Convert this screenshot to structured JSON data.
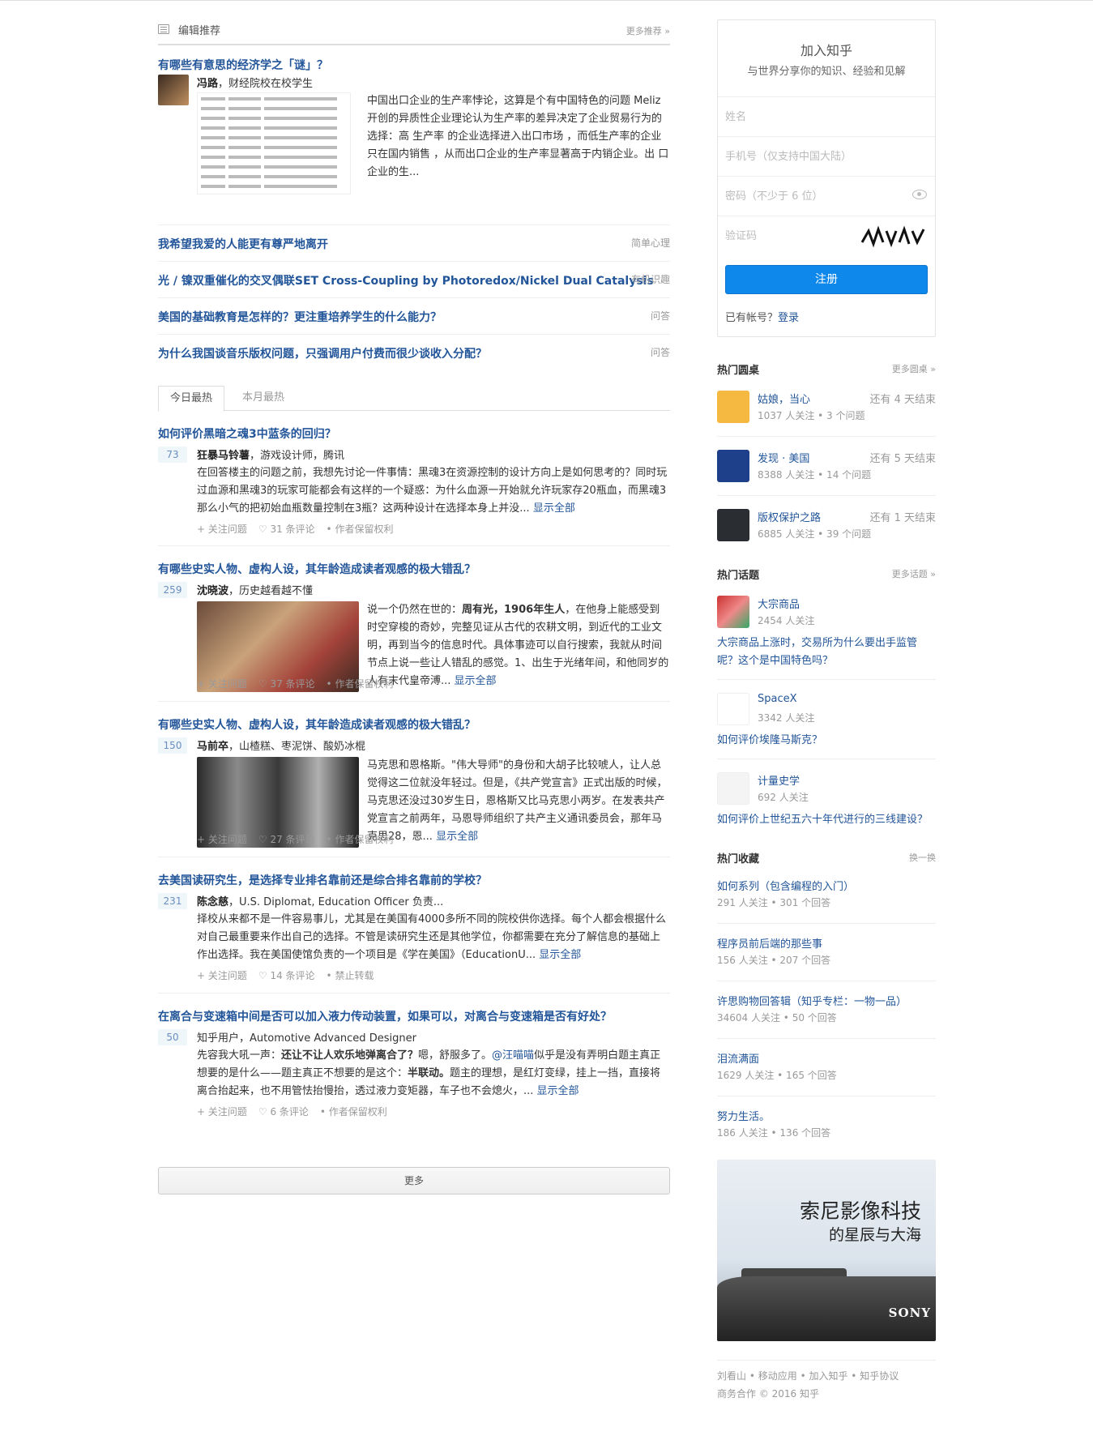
{
  "editor": {
    "section_title": "编辑推荐",
    "more": "更多推荐 »",
    "featured": {
      "question": "有哪些有意思的经济学之「谜」？",
      "author_name": "冯路",
      "author_bio": "，财经院校在校学生",
      "summary": "中国出口企业的生产率悖论，这算是个有中国特色的问题 Meliz开创的异质性企业理论认为生产率的差异决定了企业贸易行为的选择：高 生产率 的企业选择进入出口市场 ，而低生产率的企业只在国内销售 ，从而出口企业的生产率显著高于内销企业。出 口企业的生..."
    },
    "rows": [
      {
        "title": "我希望我爱的人能更有尊严地离开",
        "tag": "简单心理"
      },
      {
        "title": "光 / 镍双重催化的交叉偶联SET Cross-Coupling by Photoredox/Nickel Dual Catalysis",
        "tag": "有机识趣"
      },
      {
        "title": "美国的基础教育是怎样的？更注重培养学生的什么能力？",
        "tag": "问答"
      },
      {
        "title": "为什么我国谈音乐版权问题，只强调用户付费而很少谈收入分配？",
        "tag": "问答"
      }
    ]
  },
  "tabs": {
    "today": "今日最热",
    "month": "本月最热"
  },
  "feed": [
    {
      "question": "如何评价黑暗之魂3中蓝条的回归？",
      "votes": "73",
      "author_name": "狂暴马铃薯",
      "author_bio": "，游戏设计师，腾讯",
      "body": "在回答楼主的问题之前，我想先讨论一件事情：黑魂3在资源控制的设计方向上是如何思考的？同时玩过血源和黑魂3的玩家可能都会有这样的一个疑惑：为什么血源一开始就允许玩家存20瓶血，而黑魂3那么小气的把初始血瓶数量控制在3瓶？这两种设计在选择本身上并没...",
      "show_all": "显示全部",
      "follow": "+ 关注问题",
      "comments": "♡ 31 条评论",
      "rights": "• 作者保留权利"
    },
    {
      "question": "有哪些史实人物、虚构人设，其年龄造成读者观感的极大错乱？",
      "votes": "259",
      "author_name": "沈晓波",
      "author_bio": "，历史越看越不懂",
      "body_bold_a": "周有光，1906年生人",
      "body_pre": "说一个仍然在世的：",
      "body_post": "，在他身上能感受到时空穿梭的奇妙，完整见证从古代的农耕文明，到近代的工业文明，再到当今的信息时代。具体事迹可以自行搜索，我就从时间节点上说一些让人错乱的感觉。1、出生于光绪年间，和他同岁的人有末代皇帝溥...",
      "show_all": "显示全部",
      "follow": "+ 关注问题",
      "comments": "♡ 37 条评论",
      "rights": "• 作者保留权利"
    },
    {
      "question": "有哪些史实人物、虚构人设，其年龄造成读者观感的极大错乱？",
      "votes": "150",
      "author_name": "马前卒",
      "author_bio": "，山楂糕、枣泥饼、酸奶冰棍",
      "body": "马克思和恩格斯。\"伟大导师\"的身份和大胡子比较唬人，让人总觉得这二位就没年轻过。但是，《共产党宣言》正式出版的时候，马克思还没过30岁生日，恩格斯又比马克思小两岁。在发表共产党宣言之前两年，马恩导师组织了共产主义通讯委员会，那年马克思28，恩...",
      "show_all": "显示全部",
      "follow": "+ 关注问题",
      "comments": "♡ 27 条评论",
      "rights": "• 作者保留权利"
    },
    {
      "question": "去美国读研究生，是选择专业排名靠前还是综合排名靠前的学校？",
      "votes": "231",
      "author_name": "陈念慈",
      "author_bio": "，U.S. Diplomat, Education Officer 负责...",
      "body": "择校从来都不是一件容易事儿，尤其是在美国有4000多所不同的院校供你选择。每个人都会根据什么对自己最重要来作出自己的选择。不管是读研究生还是其他学位，你都需要在充分了解信息的基础上作出选择。我在美国使馆负责的一个项目是《学在美国》（EducationU...",
      "show_all": "显示全部",
      "follow": "+ 关注问题",
      "comments": "♡ 14 条评论",
      "rights": "• 禁止转载"
    },
    {
      "question": "在离合与变速箱中间是否可以加入液力传动装置，如果可以，对离合与变速箱是否有好处？",
      "votes": "50",
      "author_name": "知乎用户",
      "author_bio": "，Automotive Advanced Designer",
      "body_pre": "先容我大吼一声：",
      "body_bold_a": "还让不让人欢乐地弹离合了？",
      "body_mid": "嗯，舒服多了。",
      "body_mention": "@汪喵喵",
      "body_mid2": "似乎是没有弄明白题主真正想要的是什么——题主真正不想要的是这个：",
      "body_bold_b": "半联动。",
      "body_post": "题主的理想，是红灯变绿，挂上一挡，直接将离合抬起来，也不用管怯抬慢抬，透过液力变矩器，车子也不会熄火，...",
      "show_all": "显示全部",
      "follow": "+ 关注问题",
      "comments": "♡ 6 条评论",
      "rights": "• 作者保留权利"
    }
  ],
  "more_button": "更多",
  "join": {
    "title": "加入知乎",
    "subtitle": "与世界分享你的知识、经验和见解",
    "name_placeholder": "姓名",
    "phone_placeholder": "手机号（仅支持中国大陆）",
    "password_placeholder": "密码（不少于 6 位）",
    "captcha_placeholder": "验证码",
    "register": "注册",
    "have_account": "已有帐号？",
    "login": "登录"
  },
  "roundtables": {
    "title": "热门圆桌",
    "more": "更多圆桌 »",
    "items": [
      {
        "name": "姑娘，当心",
        "left": "还有 4 天结束",
        "stat": "1037 人关注 • 3 个问题"
      },
      {
        "name": "发现 · 美国",
        "left": "还有 5 天结束",
        "stat": "8388 人关注 • 14 个问题"
      },
      {
        "name": "版权保护之路",
        "left": "还有 1 天结束",
        "stat": "6885 人关注 • 39 个问题"
      }
    ]
  },
  "topics": {
    "title": "热门话题",
    "more": "更多话题 »",
    "items": [
      {
        "name": "大宗商品",
        "stat": "2454 人关注",
        "question": "大宗商品上涨时，交易所为什么要出手监管呢？这个是中国特色吗？"
      },
      {
        "name": "SpaceX",
        "stat": "3342 人关注",
        "question": "如何评价埃隆马斯克？"
      },
      {
        "name": "计量史学",
        "stat": "692 人关注",
        "question": "如何评价上世纪五六十年代进行的三线建设？"
      }
    ]
  },
  "collections": {
    "title": "热门收藏",
    "more": "换一换",
    "items": [
      {
        "name": "如何系列（包含编程的入门）",
        "stat": "291 人关注 • 301 个回答"
      },
      {
        "name": "程序员前后端的那些事",
        "stat": "156 人关注 • 207 个回答"
      },
      {
        "name": "许思购物回答辑（知乎专栏：一物一品）",
        "stat": "34604 人关注 • 50 个回答"
      },
      {
        "name": "泪流满面",
        "stat": "1629 人关注 • 165 个回答"
      },
      {
        "name": "努力生活。",
        "stat": "186 人关注 • 136 个回答"
      }
    ]
  },
  "ad": {
    "line1": "索尼影像科技",
    "line2": "的星辰与大海",
    "brand": "SONY"
  },
  "footer": {
    "links": [
      "刘看山",
      "移动应用",
      "加入知乎",
      "知乎协议"
    ],
    "line2": "商务合作 © 2016 知乎"
  },
  "colors": {
    "link": "#225599",
    "accent": "#0f88eb",
    "vote_bg": "#eff6fa"
  }
}
